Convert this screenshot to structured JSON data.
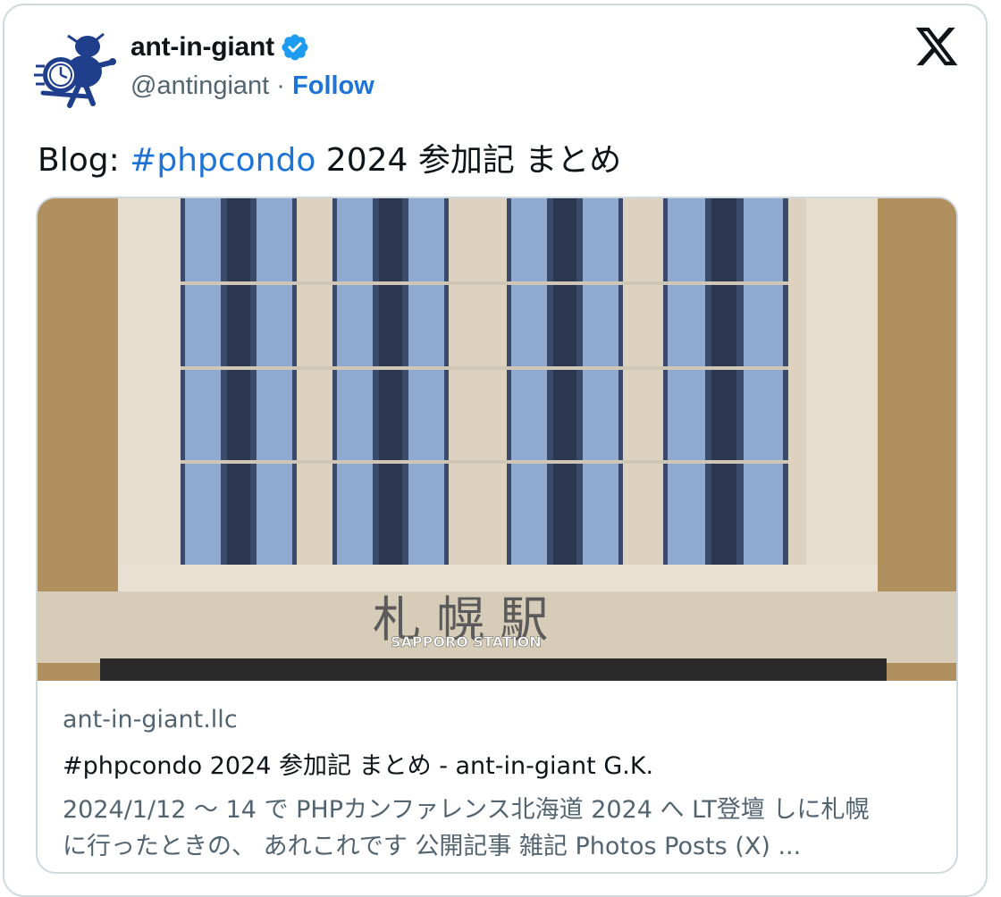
{
  "author": {
    "name": "ant-in-giant",
    "handle": "@antingiant",
    "separator": "·",
    "follow_label": "Follow"
  },
  "tweet": {
    "prefix": "Blog: ",
    "hashtag": "#phpcondo",
    "suffix": " 2024 参加記 まとめ"
  },
  "link_card": {
    "domain": "ant-in-giant.llc",
    "title": "#phpcondo 2024 参加記 まとめ - ant-in-giant G.K.",
    "description_line1": "2024/1/12 〜 14 で PHPカンファレンス北海道 2024 へ LT登壇 しに札幌",
    "description_line2": "に行ったときの、 あれこれです 公開記事 雑記 Photos Posts (X) ...",
    "photo_sign_jp": "札 幌 駅",
    "photo_sign_en": "SAPPORO STATION"
  },
  "colors": {
    "link_blue": "#1d73d8",
    "verified_blue": "#1d9bf0",
    "text_primary": "#0f1419",
    "text_secondary": "#536471",
    "border": "#cfd9de",
    "avatar_navy": "#1f3f8c"
  },
  "icons": {
    "avatar": "ant-running-with-clock-icon",
    "verified": "verified-badge-icon",
    "platform": "x-logo-icon"
  }
}
